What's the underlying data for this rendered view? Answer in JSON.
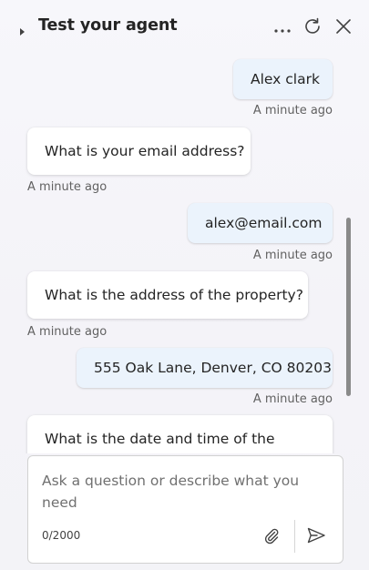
{
  "header": {
    "title": "Test your agent",
    "more_icon": "more-horizontal-icon",
    "refresh_icon": "refresh-icon",
    "close_icon": "close-icon",
    "collapse_icon": "caret-right-icon"
  },
  "messages": [
    {
      "role": "user",
      "text": "Alex clark",
      "time": "A minute ago"
    },
    {
      "role": "bot",
      "text": "What is your email address?",
      "time": "A minute ago"
    },
    {
      "role": "user",
      "text": "alex@email.com",
      "time": "A minute ago"
    },
    {
      "role": "bot",
      "text": "What is the address of the property?",
      "time": "A minute ago"
    },
    {
      "role": "user",
      "text": "555 Oak Lane, Denver, CO 80203",
      "time": "A minute ago"
    },
    {
      "role": "bot",
      "text": "What is the date and time of the"
    }
  ],
  "composer": {
    "placeholder": "Ask a question or describe what you need",
    "char_count": "0/2000",
    "attach_icon": "paperclip-icon",
    "send_icon": "send-icon"
  },
  "colors": {
    "user_bubble": "#ebf3fc",
    "bot_bubble": "#ffffff",
    "text": "#242424",
    "muted": "#616161"
  }
}
